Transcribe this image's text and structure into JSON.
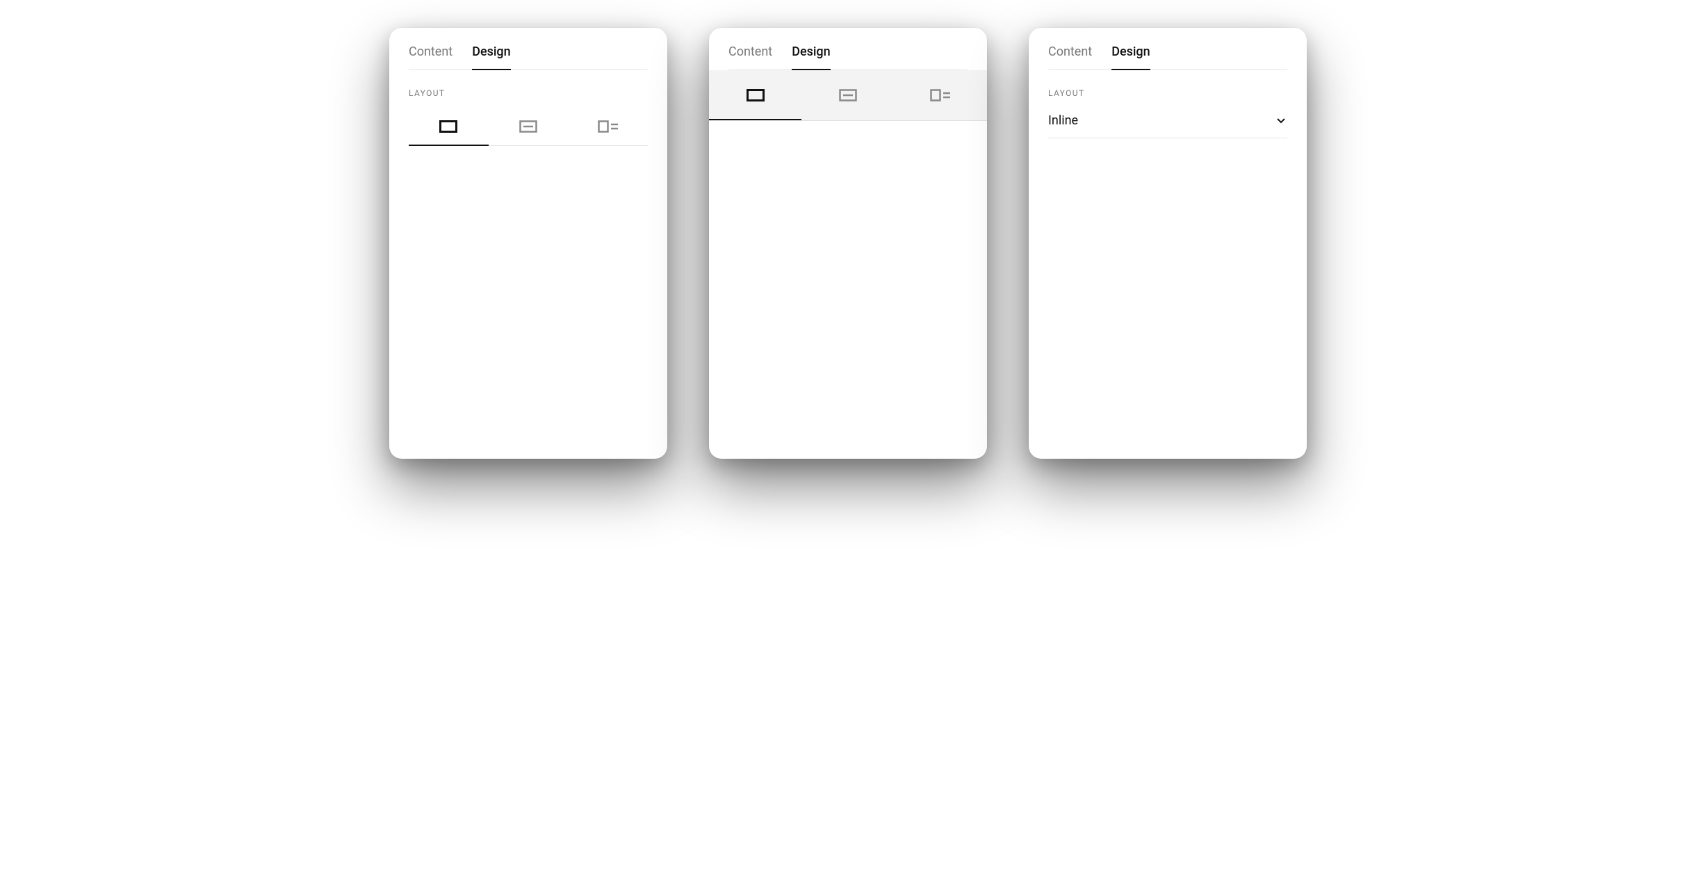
{
  "tabs": {
    "content": "Content",
    "design": "Design"
  },
  "section": {
    "layout_label": "LAYOUT"
  },
  "layout_options": {
    "inline": "Inline",
    "card": "Card",
    "float": "Float"
  },
  "dropdown": {
    "selected": "Inline"
  }
}
